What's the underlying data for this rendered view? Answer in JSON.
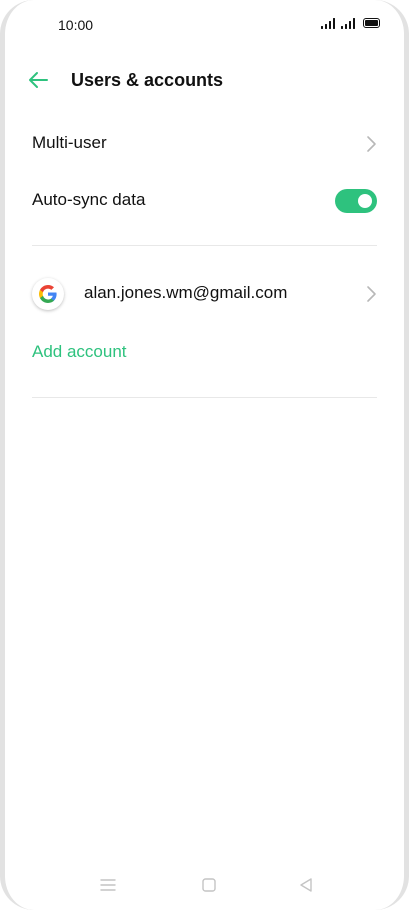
{
  "status_bar": {
    "time": "10:00",
    "icons": [
      "signal-icon",
      "signal-icon",
      "battery-icon"
    ]
  },
  "header": {
    "back_icon": "arrow-left-icon",
    "title": "Users & accounts"
  },
  "settings": {
    "multi_user_label": "Multi-user",
    "auto_sync_label": "Auto-sync data",
    "auto_sync_enabled": true
  },
  "accounts": {
    "items": [
      {
        "provider_icon": "google-icon",
        "email": "alan.jones.wm@gmail.com"
      }
    ],
    "add_account_label": "Add account"
  },
  "nav_bar": {
    "icons": [
      "menu-icon",
      "home-square-icon",
      "back-triangle-icon"
    ]
  },
  "colors": {
    "accent": "#2ec27e",
    "text": "#111111",
    "divider": "#e8e8e8",
    "chevron": "#b8b8b8"
  }
}
